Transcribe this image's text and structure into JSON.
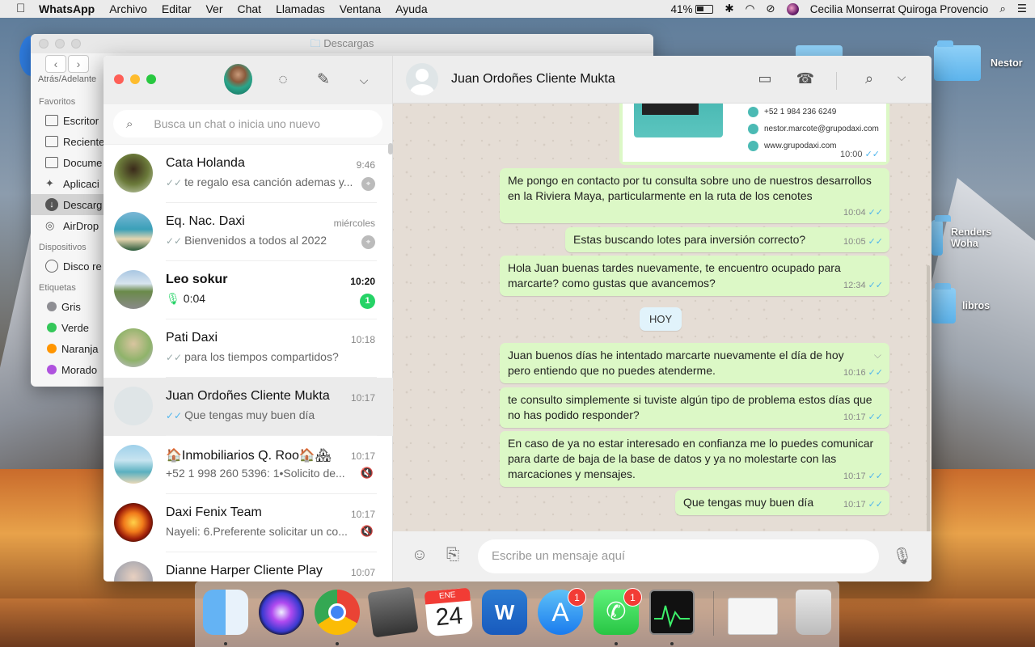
{
  "menubar": {
    "apple_icon": "apple-icon",
    "app_name": "WhatsApp",
    "menus": [
      "Archivo",
      "Editar",
      "Ver",
      "Chat",
      "Llamadas",
      "Ventana",
      "Ayuda"
    ],
    "battery": "41%",
    "user": "Cecilia Monserrat Quiroga Provencio"
  },
  "desktop": {
    "folders": [
      "Nestor",
      "Renders\nWoha",
      "libros"
    ]
  },
  "finder": {
    "title": "Descargas",
    "nav_label": "Atrás/Adelante",
    "sections": {
      "favorites": "Favoritos",
      "devices": "Dispositivos",
      "tags": "Etiquetas"
    },
    "favorites": [
      "Escritor",
      "Reciente",
      "Docume",
      "Aplicaci",
      "Descarg",
      "AirDrop"
    ],
    "devices": [
      "Disco re"
    ],
    "tags": [
      {
        "label": "Gris",
        "color": "#8e8e93"
      },
      {
        "label": "Verde",
        "color": "#34c759"
      },
      {
        "label": "Naranja",
        "color": "#ff9500"
      },
      {
        "label": "Morado",
        "color": "#af52de"
      }
    ]
  },
  "whatsapp": {
    "search_placeholder": "Busca un chat o inicia uno nuevo",
    "chats": [
      {
        "name": "Cata Holanda",
        "time": "9:46",
        "preview": "te regalo esa canción ademas y...",
        "tick": "read-grey",
        "pinned": true
      },
      {
        "name": "Eq. Nac. Daxi",
        "time": "miércoles",
        "preview": "Bienvenidos a todos al 2022",
        "tick": "read-grey",
        "pinned": true
      },
      {
        "name": "Leo sokur",
        "time": "10:20",
        "preview": "0:04",
        "voice": true,
        "unread": "1"
      },
      {
        "name": "Pati Daxi",
        "time": "10:18",
        "preview": "para los tiempos compartidos?",
        "tick": "read-grey"
      },
      {
        "name": "Juan Ordoñes Cliente Mukta",
        "time": "10:17",
        "preview": "Que tengas muy buen día",
        "tick": "read-blue",
        "selected": true
      },
      {
        "name": "🏠Inmobiliarios Q. Roo🏠🏘",
        "time": "10:17",
        "preview": "+52 1 998 260 5396: 1•Solicito de...",
        "muted": true
      },
      {
        "name": "Daxi Fenix Team",
        "time": "10:17",
        "preview": "Nayeli: 6.Preferente solicitar un co...",
        "muted": true
      },
      {
        "name": "Dianne Harper Cliente Play",
        "time": "10:07",
        "preview": ""
      }
    ],
    "conversation": {
      "contact": "Juan Ordoñes Cliente Mukta",
      "card": {
        "phone": "+52 1 984 236 6249",
        "email": "nestor.marcote@grupodaxi.com",
        "web": "www.grupodaxi.com",
        "time": "10:00"
      },
      "day_label": "HOY",
      "messages": [
        {
          "text": "Me pongo en contacto por tu consulta sobre uno de nuestros desarrollos en la Riviera Maya, particularmente en la ruta de los cenotes",
          "time": "10:04"
        },
        {
          "text": "Estas buscando lotes para inversión correcto?",
          "time": "10:05"
        },
        {
          "text": "Hola Juan buenas tardes nuevamente, te encuentro ocupado para marcarte? como gustas que avancemos?",
          "time": "12:34"
        },
        {
          "text": "Juan buenos días he intentado marcarte nuevamente el día de hoy pero entiendo que no puedes atenderme.",
          "time": "10:16"
        },
        {
          "text": "te consulto simplemente si tuviste algún tipo de problema estos días que no has podido responder?",
          "time": "10:17"
        },
        {
          "text": "En caso de ya no estar interesado en confianza me lo puedes comunicar para darte de baja de la base de datos y ya no molestarte con las marcaciones y mensajes.",
          "time": "10:17"
        },
        {
          "text": "Que tengas muy buen día",
          "time": "10:17"
        }
      ],
      "composer_placeholder": "Escribe un mensaje aquí"
    }
  },
  "dock": {
    "apps": [
      "Finder",
      "Siri",
      "Chrome",
      "Calculadora",
      "Calendario",
      "Word",
      "App Store",
      "WhatsApp",
      "Monitor de Actividad"
    ],
    "calendar_month": "ENE",
    "calendar_day": "24",
    "appstore_badge": "1",
    "whatsapp_badge": "1"
  }
}
